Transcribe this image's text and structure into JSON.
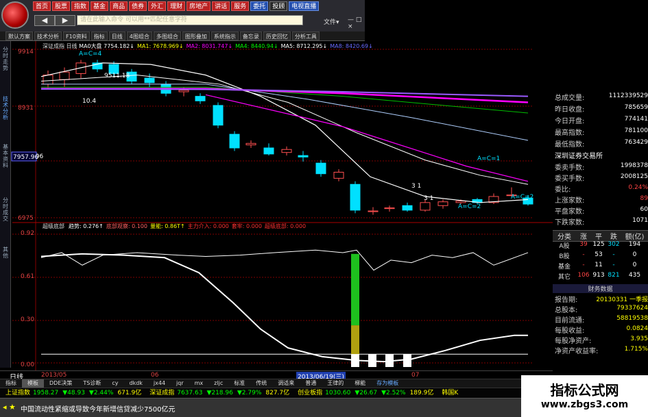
{
  "top": {
    "menu": [
      "首页",
      "股票",
      "指数",
      "基金",
      "商品",
      "债券",
      "外汇",
      "理财",
      "房地产",
      "讲话",
      "服务",
      "委托",
      "投顾",
      "电视直播"
    ],
    "back": "◀",
    "fwd": "▶",
    "cmd_placeholder": "请在此输入命令 可以用**匹配任意字符",
    "file_menu": "文件▾",
    "ctrl": "— □ ×"
  },
  "toolbar": [
    "默认方案",
    "技术分析",
    "F10资料",
    "指标",
    "日线",
    "4图组合",
    "多图组合",
    "图形叠加",
    "系统指示",
    "备忘录",
    "历史回忆",
    "分析工具"
  ],
  "vtabs": [
    "分时走势",
    "技术分析",
    "基本资料",
    "分时成交",
    "其他"
  ],
  "price_chart": {
    "title": "深证成指 日线",
    "ma": [
      {
        "label": "MA0大盘",
        "value": "7754.182↓",
        "color": "#ffffff"
      },
      {
        "label": "MA1:",
        "value": "7678.969↓",
        "color": "#ffff00"
      },
      {
        "label": "MA2:",
        "value": "8031.747↓",
        "color": "#ff00ff"
      },
      {
        "label": "MA4:",
        "value": "8440.94↓",
        "color": "#00ff00"
      },
      {
        "label": "MA5:",
        "value": "8712.295↓",
        "color": "#ffffff"
      },
      {
        "label": "MA8:",
        "value": "8420.69↓",
        "color": "#6a6aff"
      }
    ],
    "y_ticks": [
      "9914",
      "8931",
      "7957.96",
      "6975"
    ],
    "current": "7957.96",
    "annotations": [
      "A=C=4",
      "9511.18",
      "A=C=1",
      "A=C=2",
      "A=C=2",
      "3 1",
      "3 1"
    ],
    "low_label": "10.4"
  },
  "ind_chart": {
    "title": "超级底部",
    "items": [
      {
        "label": "趋势:",
        "value": "0.276↑",
        "color": "#ffffff"
      },
      {
        "label": "底部观察:",
        "value": "0.100",
        "color": "#ff6060"
      },
      {
        "label": "量能:",
        "value": "0.86T↑",
        "color": "#ffff00"
      },
      {
        "label": "主力介入:",
        "value": "0.000",
        "color": "#ff3030"
      },
      {
        "label": "套牢:",
        "value": "0.000",
        "color": "#ff3030"
      },
      {
        "label": "超级底部:",
        "value": "0.000",
        "color": "#ff3030"
      }
    ],
    "y_ticks": [
      "0.92",
      "0.61",
      "0.30",
      "0.00"
    ]
  },
  "right": {
    "rows": [
      {
        "label": "总成交量:",
        "value": "1112339529"
      },
      {
        "label": "昨日收盘:",
        "value": "785659"
      },
      {
        "label": "今日开盘:",
        "value": "774141"
      },
      {
        "label": "最高指数:",
        "value": "781100"
      },
      {
        "label": "最低指数:",
        "value": "763429"
      }
    ],
    "exchange": "深圳证券交易所",
    "rows2": [
      {
        "label": "委卖手数:",
        "value": "1998378"
      },
      {
        "label": "委买手数:",
        "value": "2008125"
      },
      {
        "label": "委比:",
        "value": "0.24%"
      },
      {
        "label": "上涨家数:",
        "value": "89"
      },
      {
        "label": "平盘家数:",
        "value": "60"
      },
      {
        "label": "下跌家数:",
        "value": "1071"
      }
    ],
    "table_head": [
      "分类",
      "涨",
      "平",
      "跌",
      "额(亿)"
    ],
    "table": [
      [
        "A股",
        "39",
        "125",
        "302",
        "194"
      ],
      [
        "B股",
        "-",
        "53",
        "-",
        "0"
      ],
      [
        "基金",
        "-",
        "11",
        "-",
        "0"
      ],
      [
        "其它",
        "106",
        "913",
        "821",
        "435"
      ]
    ],
    "fin_title": "财务数据",
    "fin": [
      {
        "label": "报告期:",
        "value": "20130331 一季报"
      },
      {
        "label": "总股本:",
        "value": "79337624"
      },
      {
        "label": "目前流通:",
        "value": "58819538"
      },
      {
        "label": "每股收益:",
        "value": "0.0824"
      },
      {
        "label": "每股净资产:",
        "value": "3.935"
      },
      {
        "label": "净资产收益率:",
        "value": "1.715%"
      }
    ]
  },
  "daybar": {
    "left": "日线",
    "dates": [
      "2013/05",
      "06",
      "2013/06/19(三)",
      "07"
    ]
  },
  "bottom_tabs": [
    "指标",
    "模板",
    "DDE决策",
    "TS诊断",
    "cy",
    "dkdk",
    "jx44",
    "jqr",
    "mx",
    "zljc",
    "标准",
    "传统",
    "调适来",
    "普通",
    "王律的",
    "梯能",
    "存为模板"
  ],
  "ticker": [
    {
      "name": "上证指数",
      "v1": "1958.27",
      "v2": "▼48.93",
      "v3": "▼2.44%",
      "v4": "671.9亿"
    },
    {
      "name": "深证成指",
      "v1": "7637.63",
      "v2": "▼218.96",
      "v3": "▼2.79%",
      "v4": "827.7亿"
    },
    {
      "name": "创业板指",
      "v1": "1030.60",
      "v2": "▼26.67",
      "v3": "▼2.52%",
      "v4": "189.9亿"
    },
    {
      "name": "韩国K",
      "v1": "",
      "v2": "",
      "v3": "",
      "v4": ""
    }
  ],
  "news": {
    "text": "中国流动性紧缩或导致今年新增信贷减少7500亿元",
    "icons": "◂ ★"
  },
  "watermark": {
    "title": "指标公式网",
    "url": "www.zbgs3.com"
  }
}
